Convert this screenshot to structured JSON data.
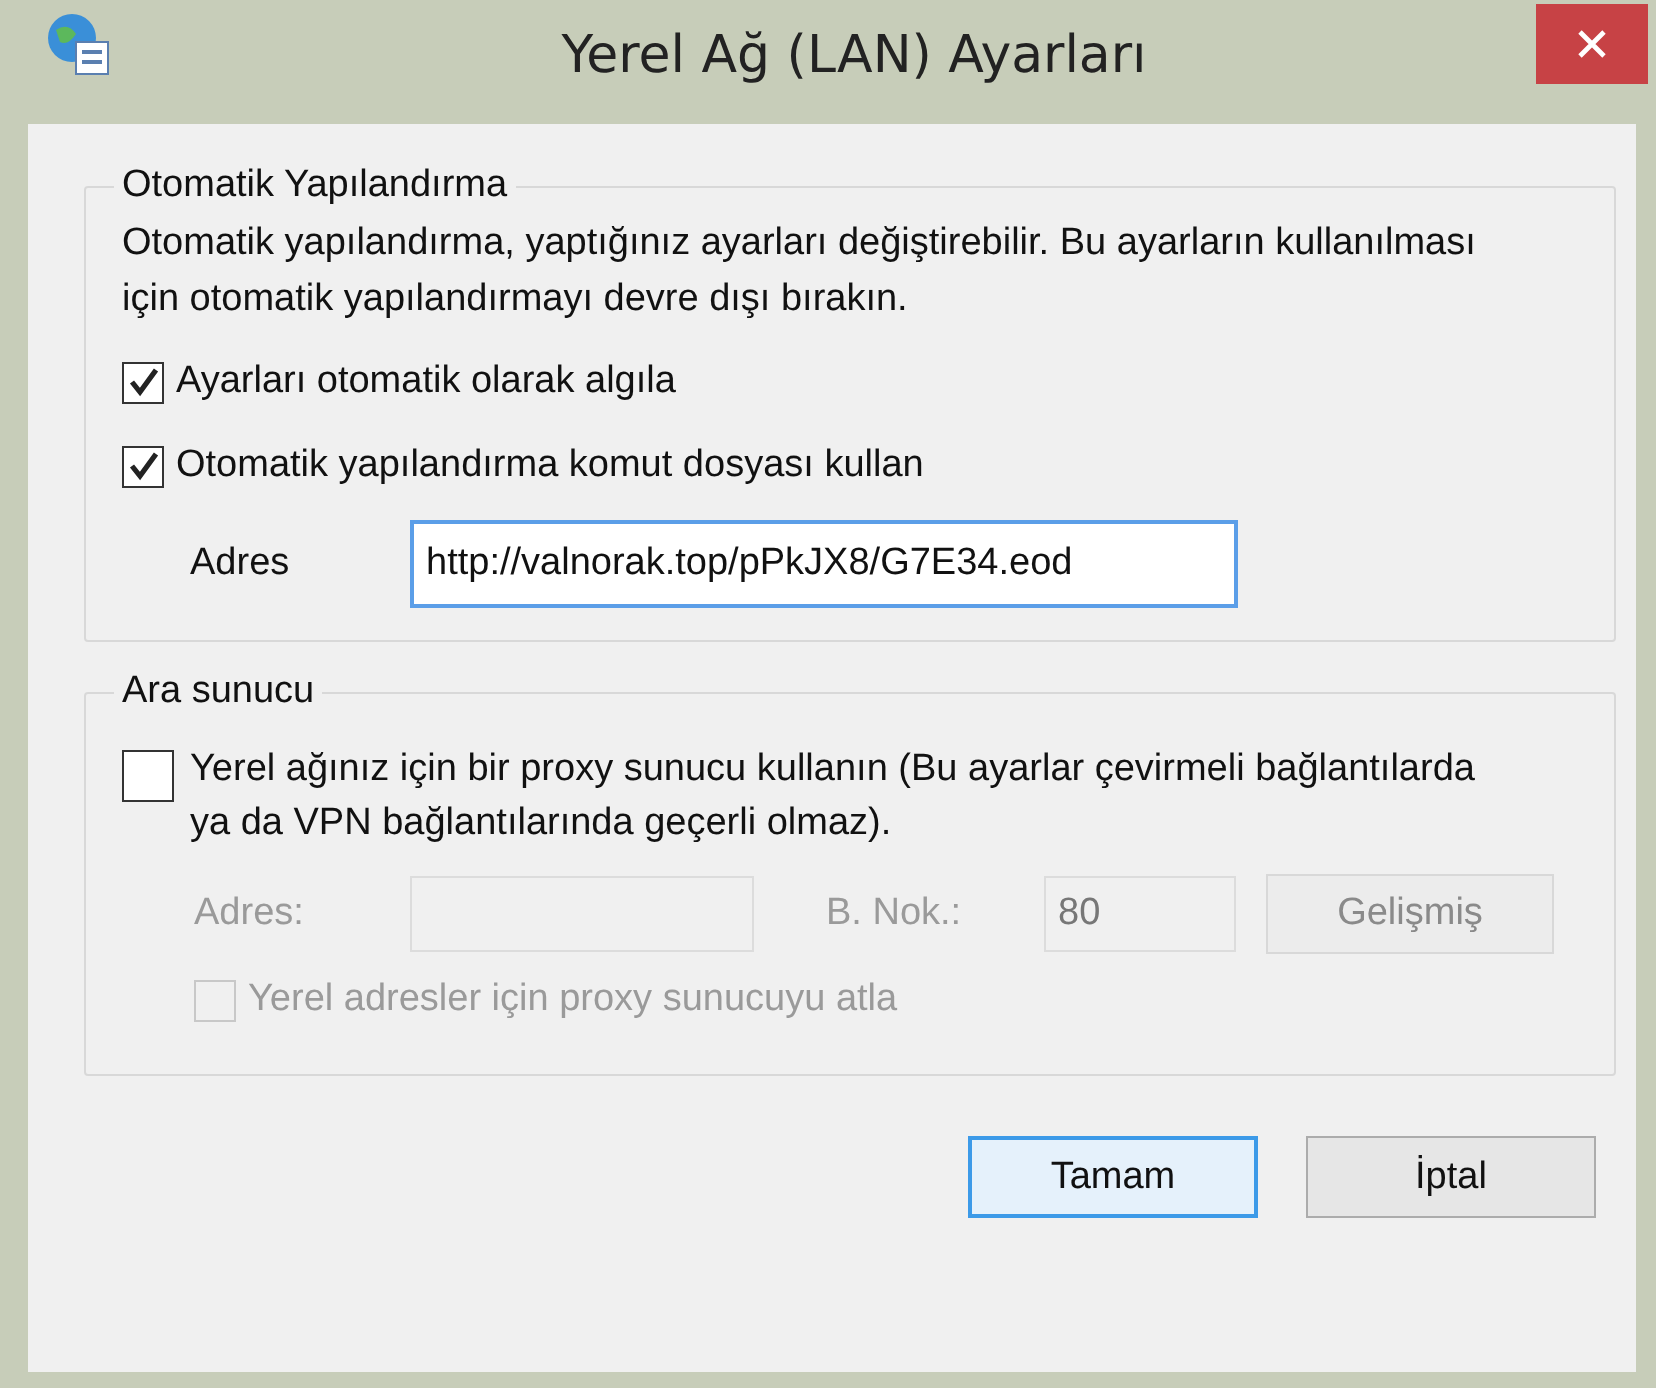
{
  "window": {
    "title": "Yerel Ağ (LAN) Ayarları"
  },
  "auto_config": {
    "title": "Otomatik Yapılandırma",
    "description": "Otomatik yapılandırma, yaptığınız ayarları değiştirebilir. Bu ayarların kullanılması için otomatik yapılandırmayı devre dışı bırakın.",
    "options": [
      {
        "label": "Ayarları otomatik olarak algıla",
        "checked": true
      },
      {
        "label": "Otomatik yapılandırma komut dosyası kullan",
        "checked": true
      }
    ],
    "address": {
      "label": "Adres",
      "value": "http://valnorak.top/pPkJX8/G7E34.eod",
      "focused": true
    }
  },
  "proxy": {
    "title": "Ara sunucu",
    "use_proxy": {
      "label": "Yerel ağınız için bir proxy sunucu kullanın (Bu ayarlar çevirmeli bağlantılarda ya da VPN bağlantılarında geçerli olmaz).",
      "checked": false
    },
    "disabled": true,
    "address_label": "Adres:",
    "port_label": "B. Nok.:",
    "port_value": "80",
    "advanced_button": "Gelişmiş",
    "bypass": {
      "label": "Yerel adresler için proxy sunucuyu atla",
      "checked": false
    }
  },
  "buttons": [
    {
      "label": "Tamam",
      "default": true
    },
    {
      "label": "İptal",
      "default": false
    }
  ]
}
